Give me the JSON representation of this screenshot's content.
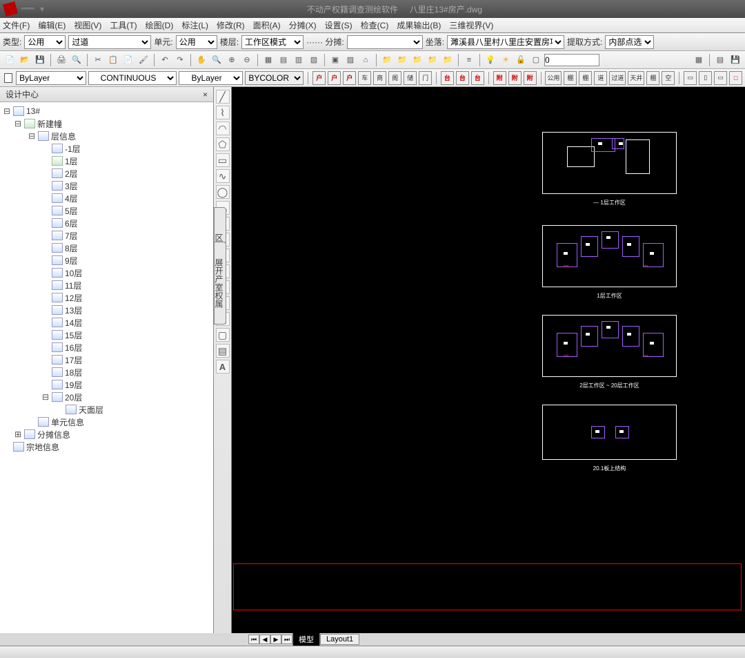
{
  "window": {
    "app_name": "不动产权籍调查测绘软件",
    "doc_name": "八里庄13#房产.dwg",
    "qa_tab": ""
  },
  "menu": [
    "文件(F)",
    "编辑(E)",
    "视图(V)",
    "工具(T)",
    "绘图(D)",
    "标注(L)",
    "修改(R)",
    "面积(A)",
    "分摊(X)",
    "设置(S)",
    "检查(C)",
    "成果输出(B)",
    "三维视界(V)"
  ],
  "opt": {
    "type_label": "类型:",
    "type_value": "公用",
    "hall_value": "过道",
    "unit_label": "单元:",
    "unit_value": "公用",
    "floor_label": "楼层:",
    "floor_value": "工作区模式",
    "share_label": "······ 分摊:",
    "loc_label": "坐落:",
    "loc_value": "濉溪县八里村八里庄安置房项目",
    "extract_label": "提取方式:",
    "extract_value": "内部点选"
  },
  "prop": {
    "layer": "ByLayer",
    "linetype": "CONTINUOUS",
    "lineweight": "ByLayer",
    "color": "BYCOLOR"
  },
  "btns2": [
    "户",
    "户",
    "户",
    "车",
    "商",
    "阁",
    "储",
    "门",
    "台",
    "台",
    "台",
    "附",
    "附",
    "附",
    "公用",
    "棚",
    "棚",
    "道",
    "过道",
    "天井",
    "棚",
    "空"
  ],
  "panel": {
    "title": "设计中心"
  },
  "tree": {
    "root": "13#",
    "newbld": "新建幢",
    "floorinfo": "层信息",
    "floors": [
      "-1层",
      "1层",
      "2层",
      "3层",
      "4层",
      "5层",
      "6层",
      "7层",
      "8层",
      "9层",
      "10层",
      "11层",
      "12层",
      "13层",
      "14层",
      "15层",
      "16层",
      "17层",
      "18层",
      "19层",
      "20层"
    ],
    "roof": "天面层",
    "unit": "单元信息",
    "share": "分摊信息",
    "land": "宗地信息"
  },
  "vtab1": "区域",
  "vtab2": "展开产室权属",
  "canvas_labels": [
    "— 1层工作区",
    "1层工作区",
    "2层工作区 ~ 20层工作区",
    "20.1板上结构"
  ],
  "tabs": {
    "model": "模型",
    "layout": "Layout1"
  }
}
